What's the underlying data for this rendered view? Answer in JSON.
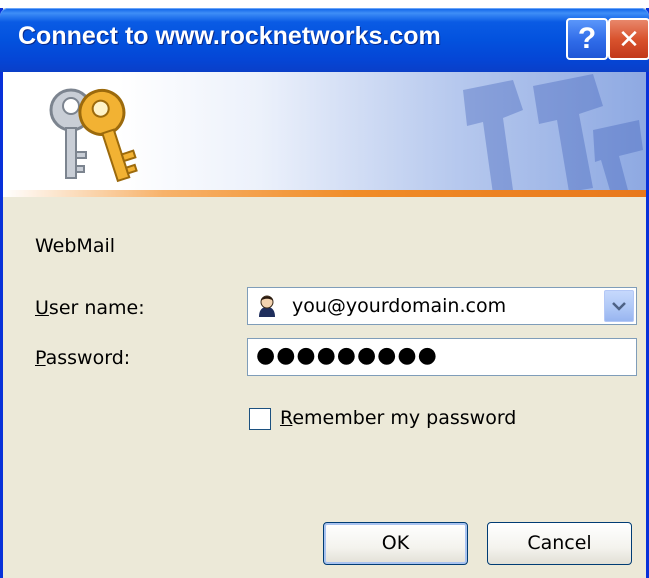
{
  "window": {
    "title": "Connect to www.rocknetworks.com",
    "help_symbol": "?",
    "close_symbol": "✕"
  },
  "icons": {
    "banner": "keys-icon",
    "user": "user-icon",
    "dropdown": "chevron-down-icon"
  },
  "form": {
    "realm": "WebMail",
    "username_label_accesskey": "U",
    "username_label_rest": "ser name:",
    "username_value": "you@yourdomain.com",
    "password_label_accesskey": "P",
    "password_label_rest": "assword:",
    "password_mask": "●●●●●●●●●",
    "remember_accesskey": "R",
    "remember_rest": "emember my password",
    "remember_checked": false
  },
  "buttons": {
    "ok": "OK",
    "cancel": "Cancel"
  },
  "colors": {
    "titlebar": "#0352DE",
    "dialog_bg": "#ECE9D8",
    "close_button": "#D9532E",
    "banner_stripe": "#F08C28"
  }
}
